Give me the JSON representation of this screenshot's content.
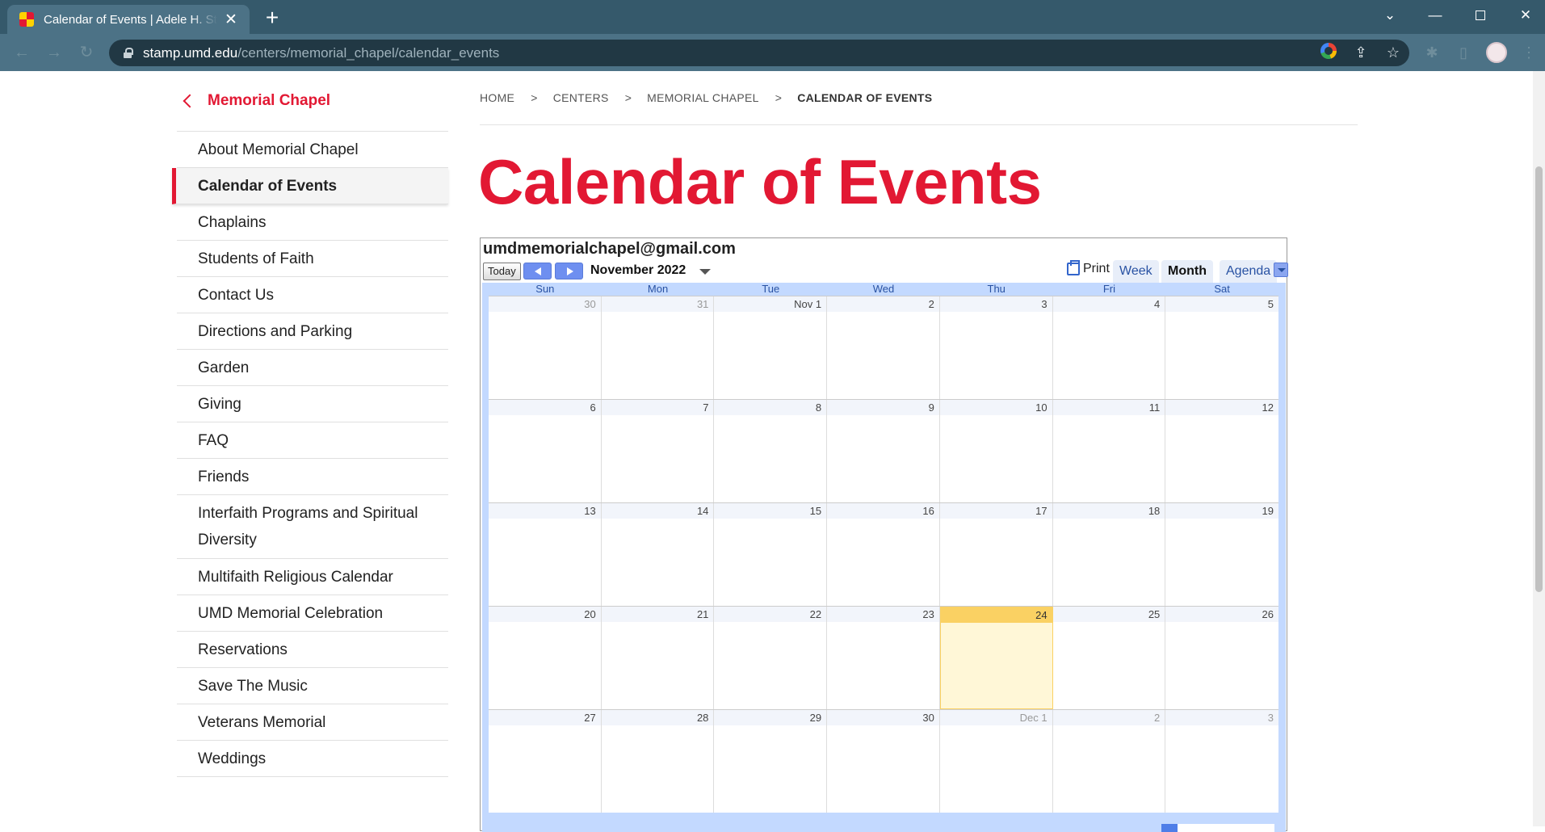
{
  "browser": {
    "tab_title": "Calendar of Events | Adele H. Stamp Student Union",
    "tab_close": "✕",
    "new_tab": "+",
    "url_host": "stamp.umd.edu",
    "url_path": "/centers/memorial_chapel/calendar_events"
  },
  "sidebar": {
    "parent": "Memorial Chapel",
    "items": [
      "About Memorial Chapel",
      "Calendar of Events",
      "Chaplains",
      "Students of Faith",
      "Contact Us",
      "Directions and Parking",
      "Garden",
      "Giving",
      "FAQ",
      "Friends",
      "Interfaith Programs and Spiritual Diversity",
      "Multifaith Religious Calendar",
      "UMD Memorial Celebration",
      "Reservations",
      "Save The Music",
      "Veterans Memorial",
      "Weddings"
    ]
  },
  "breadcrumb": {
    "items": [
      "HOME",
      "CENTERS",
      "MEMORIAL CHAPEL",
      "CALENDAR OF EVENTS"
    ],
    "separator": ">"
  },
  "page": {
    "title": "Calendar of Events"
  },
  "calendar": {
    "account": "umdmemorialchapel@gmail.com",
    "today_label": "Today",
    "month_label": "November 2022",
    "print_label": "Print",
    "views": {
      "week": "Week",
      "month": "Month",
      "agenda": "Agenda"
    },
    "days_of_week": [
      "Sun",
      "Mon",
      "Tue",
      "Wed",
      "Thu",
      "Fri",
      "Sat"
    ],
    "weeks": [
      [
        "30",
        "31",
        "Nov 1",
        "2",
        "3",
        "4",
        "5"
      ],
      [
        "6",
        "7",
        "8",
        "9",
        "10",
        "11",
        "12"
      ],
      [
        "13",
        "14",
        "15",
        "16",
        "17",
        "18",
        "19"
      ],
      [
        "20",
        "21",
        "22",
        "23",
        "24",
        "25",
        "26"
      ],
      [
        "27",
        "28",
        "29",
        "30",
        "Dec 1",
        "2",
        "3"
      ]
    ],
    "other_month_cells": [
      [
        0,
        0
      ],
      [
        0,
        1
      ],
      [
        4,
        4
      ],
      [
        4,
        5
      ],
      [
        4,
        6
      ]
    ],
    "today_cell": [
      3,
      4
    ]
  }
}
